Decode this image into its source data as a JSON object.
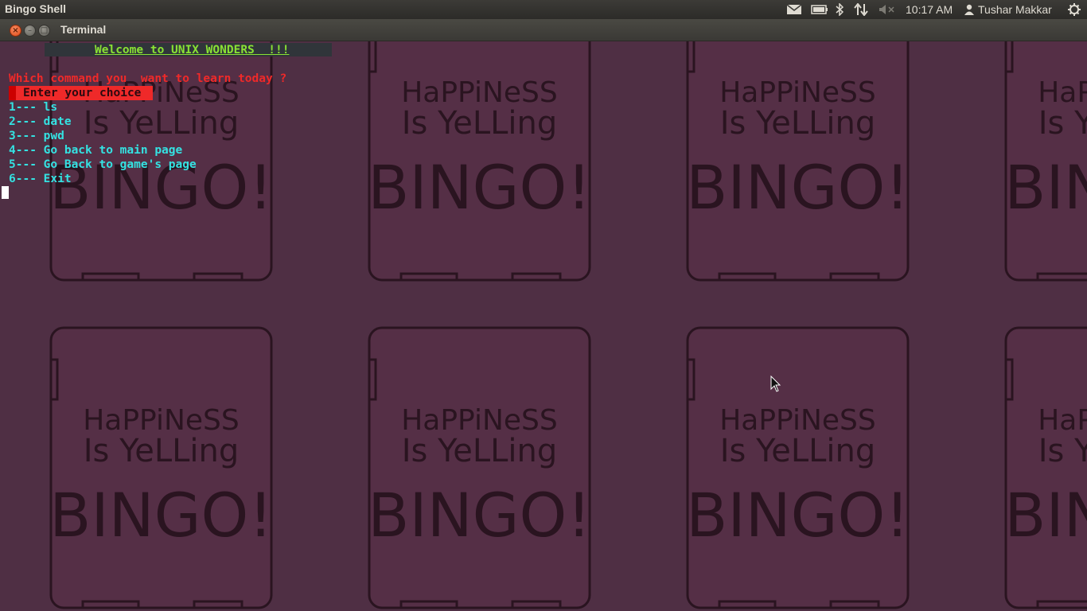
{
  "panel": {
    "app_title": "Bingo Shell",
    "indicators": [
      "mail-icon",
      "battery-icon",
      "bluetooth-icon",
      "network-icon",
      "volume-muted-icon"
    ],
    "clock": "10:17 AM",
    "user": "Tushar Makkar",
    "session_icon": "gear-icon"
  },
  "window": {
    "title": "Terminal",
    "close_label": "×",
    "minimize_label": "–",
    "maximize_label": "□"
  },
  "terminal": {
    "banner": "Welcome to UNIX WONDERS  !!!",
    "question": "Which command you  want to learn today ?",
    "prompt": "Enter your choice",
    "menu": [
      "1--- ls",
      "2--- date",
      "3--- pwd",
      "4--- Go back to main page",
      "5--- Go Back to game's page",
      "6--- Exit"
    ]
  },
  "wallpaper": {
    "line1": "HaPPiNeSS",
    "line2": "Is YeLLing",
    "line3": "BINGO!"
  },
  "colors": {
    "background": "#4f2f44",
    "card": "#552f46",
    "card_outline": "#2a1420",
    "banner_text": "#8ae234",
    "question_text": "#ef2929",
    "menu_text": "#34e2e2"
  }
}
